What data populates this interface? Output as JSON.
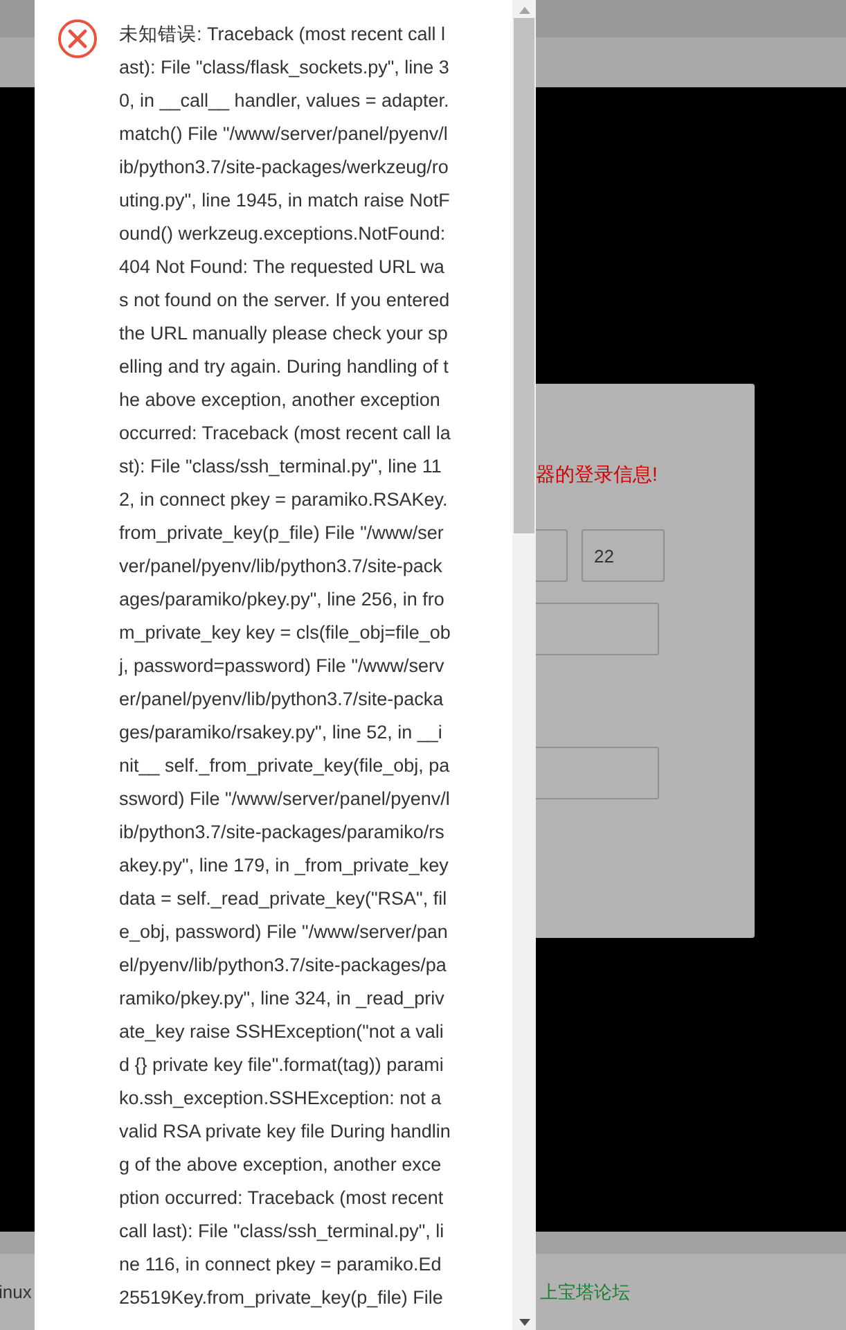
{
  "background": {
    "dialog": {
      "notice": "器的登录信息!",
      "port_field": {
        "value": "22"
      }
    },
    "footer": {
      "left_text": "inux",
      "link": "上宝塔论坛"
    }
  },
  "error_popup": {
    "message": "未知错误: Traceback (most recent call last): File \"class/flask_sockets.py\", line 30, in __call__ handler, values = adapter.match() File \"/www/server/panel/pyenv/lib/python3.7/site-packages/werkzeug/routing.py\", line 1945, in match raise NotFound() werkzeug.exceptions.NotFound: 404 Not Found: The requested URL was not found on the server. If you entered the URL manually please check your spelling and try again. During handling of the above exception, another exception occurred: Traceback (most recent call last): File \"class/ssh_terminal.py\", line 112, in connect pkey = paramiko.RSAKey.from_private_key(p_file) File \"/www/server/panel/pyenv/lib/python3.7/site-packages/paramiko/pkey.py\", line 256, in from_private_key key = cls(file_obj=file_obj, password=password) File \"/www/server/panel/pyenv/lib/python3.7/site-packages/paramiko/rsakey.py\", line 52, in __init__ self._from_private_key(file_obj, password) File \"/www/server/panel/pyenv/lib/python3.7/site-packages/paramiko/rsakey.py\", line 179, in _from_private_key data = self._read_private_key(\"RSA\", file_obj, password) File \"/www/server/panel/pyenv/lib/python3.7/site-packages/paramiko/pkey.py\", line 324, in _read_private_key raise SSHException(\"not a valid {} private key file\".format(tag)) paramiko.ssh_exception.SSHException: not a valid RSA private key file During handling of the above exception, another exception occurred: Traceback (most recent call last): File \"class/ssh_terminal.py\", line 116, in connect pkey = paramiko.Ed25519Key.from_private_key(p_file) File"
  }
}
